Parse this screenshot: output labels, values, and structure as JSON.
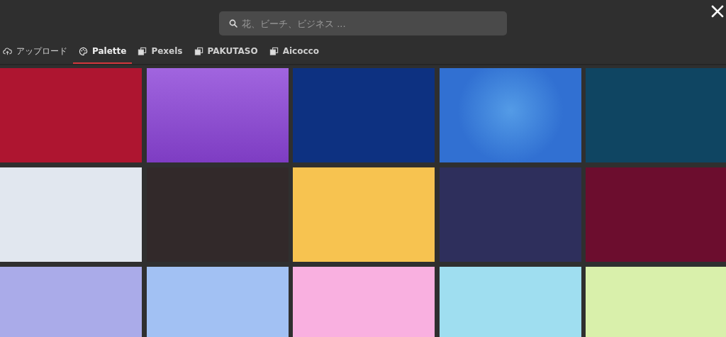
{
  "search": {
    "placeholder": "花、ビーチ、ビジネス ..."
  },
  "tabs": [
    {
      "label": "アップロード",
      "selected": false
    },
    {
      "label": "Palette",
      "selected": true
    },
    {
      "label": "Pexels",
      "selected": false
    },
    {
      "label": "PAKUTASO",
      "selected": false
    },
    {
      "label": "Aicocco",
      "selected": false
    }
  ],
  "swatches": [
    {
      "kind": "solid",
      "color": "#ae1530"
    },
    {
      "kind": "linear",
      "color": "#8c43d8"
    },
    {
      "kind": "solid",
      "color": "#0d3181"
    },
    {
      "kind": "radial",
      "color": "#3170d2"
    },
    {
      "kind": "solid",
      "color": "#0f4562"
    },
    {
      "kind": "solid",
      "color": "#e1e7ef"
    },
    {
      "kind": "solid",
      "color": "#32292a"
    },
    {
      "kind": "solid",
      "color": "#f7c350"
    },
    {
      "kind": "solid",
      "color": "#2e2f5c"
    },
    {
      "kind": "solid",
      "color": "#6c0d2e"
    },
    {
      "kind": "solid",
      "color": "#aaabe9"
    },
    {
      "kind": "solid",
      "color": "#a2c1f3"
    },
    {
      "kind": "solid",
      "color": "#f9b0e0"
    },
    {
      "kind": "solid",
      "color": "#9fdef0"
    },
    {
      "kind": "solid",
      "color": "#d9f0ab"
    }
  ]
}
